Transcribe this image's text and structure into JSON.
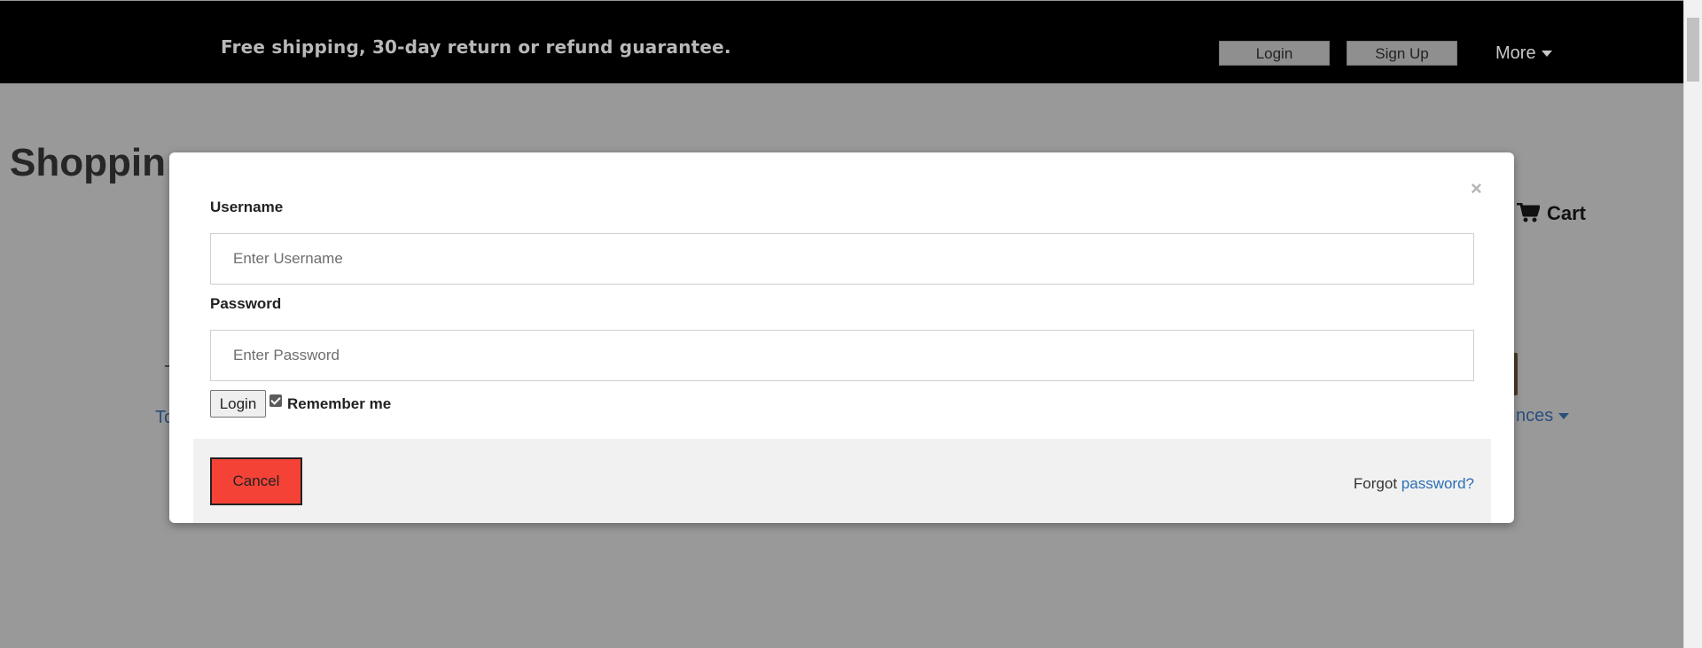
{
  "topbar": {
    "promo": "Free shipping, 30-day return or refund guarantee.",
    "login_label": "Login",
    "signup_label": "Sign Up",
    "more_label": "More"
  },
  "page": {
    "title_visible": "Shoppin",
    "cart_label": "Cart",
    "left_link_fragment": "To",
    "right_link_fragment": "nces"
  },
  "modal": {
    "close_symbol": "×",
    "username_label": "Username",
    "username_placeholder": "Enter Username",
    "password_label": "Password",
    "password_placeholder": "Enter Password",
    "login_button": "Login",
    "remember_label": "Remember me",
    "remember_checked": true,
    "cancel_button": "Cancel",
    "forgot_text": "Forgot",
    "forgot_link": "password?"
  },
  "colors": {
    "topbar_bg": "#000000",
    "overlay_bg": "#999999",
    "cancel_bg": "#f44336",
    "link": "#2c6fb3"
  }
}
